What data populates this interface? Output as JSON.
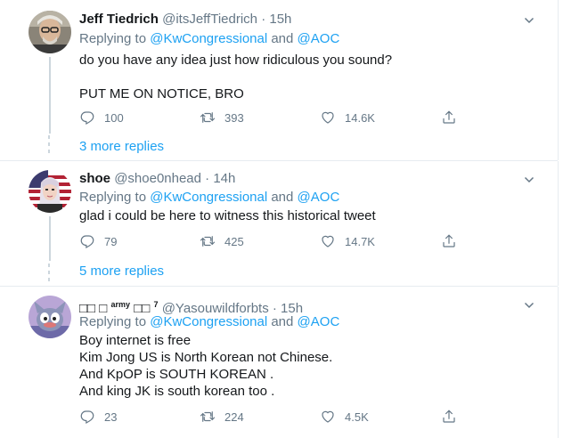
{
  "tweets": [
    {
      "name": "Jeff Tiedrich",
      "handle": "@itsJeffTiedrich",
      "sep": "·",
      "time": "15h",
      "replying_prefix": "Replying to",
      "mention1": "@KwCongressional",
      "and": "and",
      "mention2": "@AOC",
      "body": "do you have any idea just how ridiculous you sound?\n\nPUT ME ON NOTICE, BRO",
      "replies": "100",
      "retweets": "393",
      "likes": "14.6K",
      "more_replies": "3 more replies"
    },
    {
      "name": "shoe",
      "handle": "@shoe0nhead",
      "sep": "·",
      "time": "14h",
      "replying_prefix": "Replying to",
      "mention1": "@KwCongressional",
      "and": "and",
      "mention2": "@AOC",
      "body": "glad i could be here to witness this historical tweet",
      "replies": "79",
      "retweets": "425",
      "likes": "14.7K",
      "more_replies": "5 more replies"
    },
    {
      "name_part1": "□□ □",
      "name_sup1": "army",
      "name_part2": "□□",
      "name_sup2": "7",
      "handle": "@Yasouwildforbts",
      "sep": "·",
      "time": "15h",
      "replying_prefix": "Replying to",
      "mention1": "@KwCongressional",
      "and": "and",
      "mention2": "@AOC",
      "body": "Boy internet is free\nKim Jong US is North Korean not Chinese.\nAnd KpOP is SOUTH KOREAN .\nAnd king JK is south korean too .",
      "replies": "23",
      "retweets": "224",
      "likes": "4.5K"
    }
  ],
  "icons": {
    "reply": "reply-icon",
    "retweet": "retweet-icon",
    "like": "heart-icon",
    "share": "share-icon",
    "more": "chevron-down-icon"
  },
  "colors": {
    "link": "#1da1f2",
    "muted": "#657786",
    "text": "#14171a",
    "border": "#e6ecf0"
  }
}
